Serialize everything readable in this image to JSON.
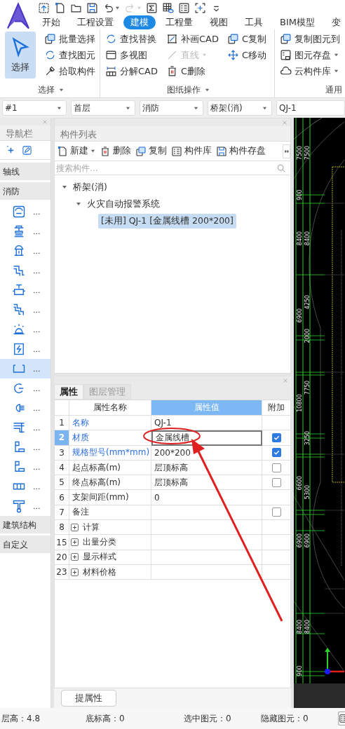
{
  "quick_access": [
    {
      "dropdown": false,
      "disabled": false
    },
    {
      "dropdown": false,
      "disabled": false
    },
    {
      "dropdown": false,
      "disabled": false
    },
    {
      "dropdown": false,
      "disabled": false
    },
    {
      "dropdown": true,
      "disabled": false
    },
    {
      "dropdown": true,
      "disabled": true
    },
    {
      "dropdown": false,
      "disabled": false
    },
    {
      "dropdown": false,
      "disabled": false
    },
    {
      "dropdown": false,
      "disabled": false
    },
    {
      "dropdown": false,
      "disabled": false
    },
    {
      "dropdown": false,
      "disabled": false
    }
  ],
  "tabs": [
    {
      "label": "开始",
      "selected": false
    },
    {
      "label": "工程设置",
      "selected": false
    },
    {
      "label": "建模",
      "selected": true
    },
    {
      "label": "工程量",
      "selected": false
    },
    {
      "label": "视图",
      "selected": false
    },
    {
      "label": "工具",
      "selected": false
    },
    {
      "label": "BIM模型",
      "selected": false
    },
    {
      "label": "变",
      "selected": false
    }
  ],
  "ribbon": {
    "groups": [
      {
        "label": "选择",
        "caret": true,
        "columns": [
          [
            {
              "kind": "large",
              "label": "选择",
              "selected": true
            }
          ],
          [
            {
              "kind": "small",
              "label": "批量选择",
              "dropdown": false,
              "disabled": false
            },
            {
              "kind": "small",
              "label": "查找图元",
              "dropdown": false,
              "disabled": false
            },
            {
              "kind": "small",
              "label": "拾取构件",
              "dropdown": false,
              "disabled": false
            }
          ]
        ]
      },
      {
        "label": "图纸操作",
        "caret": true,
        "columns": [
          [
            {
              "kind": "small",
              "label": "查找替换",
              "dropdown": false,
              "disabled": false
            },
            {
              "kind": "small",
              "label": "多视图",
              "dropdown": false,
              "disabled": false
            },
            {
              "kind": "small",
              "label": "分解CAD",
              "dropdown": false,
              "disabled": false
            }
          ],
          [
            {
              "kind": "small",
              "label": "补画CAD",
              "dropdown": false,
              "disabled": false
            },
            {
              "kind": "small",
              "label": "直线",
              "dropdown": true,
              "disabled": true
            },
            {
              "kind": "small",
              "label": "C删除",
              "dropdown": false,
              "disabled": false
            }
          ],
          [
            {
              "kind": "small",
              "label": "C复制",
              "dropdown": false,
              "disabled": false
            },
            {
              "kind": "small",
              "label": "C移动",
              "dropdown": false,
              "disabled": false
            }
          ]
        ]
      },
      {
        "label": "通用",
        "caret": false,
        "columns": [
          [
            {
              "kind": "small",
              "label": "复制图元到",
              "dropdown": false,
              "disabled": false
            },
            {
              "kind": "small",
              "label": "图元存盘",
              "dropdown": true,
              "disabled": false
            },
            {
              "kind": "small",
              "label": "云构件库",
              "dropdown": true,
              "disabled": false
            }
          ]
        ]
      }
    ]
  },
  "selectors": [
    {
      "value": "#1",
      "caret": true
    },
    {
      "value": "首层",
      "caret": true
    },
    {
      "value": "消防",
      "caret": true
    },
    {
      "value": "桥架(消)",
      "caret": true
    },
    {
      "value": "QJ-1",
      "caret": false
    }
  ],
  "nav": {
    "title": "导航栏",
    "items": [
      {
        "kind": "category",
        "label": "轴线"
      },
      {
        "kind": "category",
        "label": "消防"
      },
      {
        "kind": "tool",
        "label": "...",
        "selected": false
      },
      {
        "kind": "tool",
        "label": "...",
        "selected": false
      },
      {
        "kind": "tool",
        "label": "...",
        "selected": false
      },
      {
        "kind": "tool",
        "label": "...",
        "selected": false
      },
      {
        "kind": "tool",
        "label": "...",
        "selected": false
      },
      {
        "kind": "tool",
        "label": "...",
        "selected": false
      },
      {
        "kind": "tool",
        "label": "...",
        "selected": false
      },
      {
        "kind": "tool",
        "label": "...",
        "selected": false
      },
      {
        "kind": "tool",
        "label": "...",
        "selected": true
      },
      {
        "kind": "tool",
        "label": "...",
        "selected": false
      },
      {
        "kind": "tool",
        "label": "...",
        "selected": false
      },
      {
        "kind": "tool",
        "label": "...",
        "selected": false
      },
      {
        "kind": "tool",
        "label": "...",
        "selected": false
      },
      {
        "kind": "tool",
        "label": "...",
        "selected": false
      },
      {
        "kind": "tool",
        "label": "...",
        "selected": false
      },
      {
        "kind": "tool",
        "label": "...",
        "selected": false
      },
      {
        "kind": "category",
        "label": "建筑结构"
      },
      {
        "kind": "category",
        "label": "自定义"
      }
    ]
  },
  "components": {
    "title": "构件列表",
    "toolbar": [
      {
        "label": "新建",
        "dropdown": true
      },
      {
        "label": "删除",
        "dropdown": false
      },
      {
        "label": "复制",
        "dropdown": false
      },
      {
        "label": "构件库",
        "dropdown": false
      },
      {
        "label": "构件存盘",
        "dropdown": false
      }
    ],
    "search": {
      "placeholder": "搜索构件..."
    },
    "tree": [
      {
        "label": "桥架(消)",
        "expanded": true,
        "selected": false,
        "children": [
          {
            "label": "火灾自动报警系统",
            "expanded": true,
            "selected": false,
            "children": [
              {
                "label": "[未用] QJ-1 [金属线槽 200*200]",
                "selected": true
              }
            ]
          }
        ]
      }
    ]
  },
  "properties": {
    "tabs": [
      {
        "label": "属性",
        "selected": true
      },
      {
        "label": "图层管理",
        "selected": false
      }
    ],
    "columns": [
      {
        "label": "属性名称",
        "selected": false
      },
      {
        "label": "属性值",
        "selected": true
      },
      {
        "label": "附加",
        "selected": false
      }
    ],
    "rows": [
      {
        "kind": "field",
        "number": "1",
        "name": "名称",
        "value": "QJ-1",
        "emphasized": true,
        "selected": false
      },
      {
        "kind": "field",
        "number": "2",
        "name": "材质",
        "value": "金属线槽",
        "emphasized": true,
        "selected": true,
        "checked": true
      },
      {
        "kind": "field",
        "number": "3",
        "name": "规格型号(mm*mm)",
        "value": "200*200",
        "emphasized": true,
        "selected": false,
        "checked": true
      },
      {
        "kind": "field",
        "number": "4",
        "name": "起点标高(m)",
        "value": "层顶标高",
        "emphasized": false,
        "selected": false,
        "checked": false
      },
      {
        "kind": "field",
        "number": "5",
        "name": "终点标高(m)",
        "value": "层顶标高",
        "emphasized": false,
        "selected": false,
        "checked": false
      },
      {
        "kind": "field",
        "number": "6",
        "name": "支架间距(mm)",
        "value": "0",
        "emphasized": false,
        "selected": false
      },
      {
        "kind": "field",
        "number": "7",
        "name": "备注",
        "emphasized": false,
        "selected": false,
        "checked": false
      },
      {
        "kind": "group",
        "number": "8",
        "name": "计算",
        "expanded": false,
        "selected": false
      },
      {
        "kind": "group",
        "number": "15",
        "name": "出量分类",
        "expanded": false,
        "selected": false
      },
      {
        "kind": "group",
        "number": "20",
        "name": "显示样式",
        "expanded": false,
        "selected": false
      },
      {
        "kind": "group",
        "number": "23",
        "name": "材料价格",
        "expanded": false,
        "selected": false
      }
    ],
    "button": "提属性"
  },
  "cad": {
    "dimension_labels": [
      [
        "7500",
        "900",
        "8400",
        "6900",
        "10800",
        "6600",
        "6900",
        "8400",
        "900"
      ],
      [
        "7500",
        "8400",
        "4250",
        "2000",
        "7750",
        "3250",
        "5300",
        "6900",
        "8400"
      ]
    ]
  },
  "status_bar": {
    "items": [
      "层高：4.8",
      "底标高：0",
      "选中图元：0",
      "隐藏图元：0"
    ]
  }
}
